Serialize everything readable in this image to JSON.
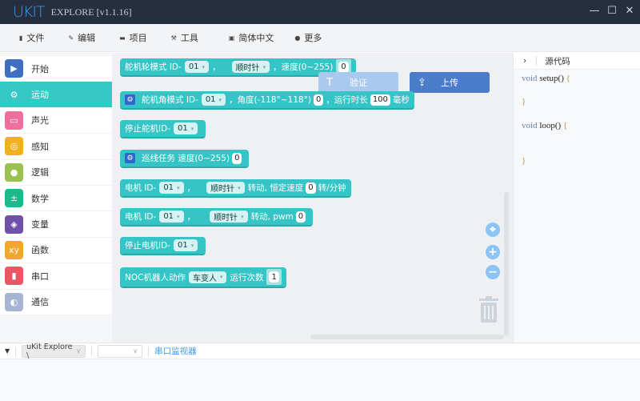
{
  "window": {
    "logo": "UKIT",
    "title": "EXPLORE [v1.1.16]",
    "minimize": "—",
    "maximize": "☐",
    "close": "✕"
  },
  "menu": [
    {
      "icon": "file-icon",
      "label": "文件"
    },
    {
      "icon": "edit-icon",
      "label": "编辑"
    },
    {
      "icon": "folder-icon",
      "label": "项目"
    },
    {
      "icon": "wrench-icon",
      "label": "工具"
    },
    {
      "icon": "language-icon",
      "label": "简体中文"
    },
    {
      "icon": "help-icon",
      "label": "更多"
    }
  ],
  "categories": [
    {
      "label": "开始",
      "color": "#3f6fc0",
      "glyph": "▶"
    },
    {
      "label": "运动",
      "color": "#35c9c6",
      "glyph": "⚙",
      "active": true
    },
    {
      "label": "声光",
      "color": "#ee6e9d",
      "glyph": "▭"
    },
    {
      "label": "感知",
      "color": "#f0b020",
      "glyph": "◎"
    },
    {
      "label": "逻辑",
      "color": "#9ac251",
      "glyph": "●"
    },
    {
      "label": "数学",
      "color": "#1db98a",
      "glyph": "±"
    },
    {
      "label": "变量",
      "color": "#7051a9",
      "glyph": "◈"
    },
    {
      "label": "函数",
      "color": "#f2a630",
      "glyph": "xy"
    },
    {
      "label": "串口",
      "color": "#e95763",
      "glyph": "▮"
    },
    {
      "label": "通信",
      "color": "#a6b5d3",
      "glyph": "◐"
    }
  ],
  "blocks": {
    "b1": {
      "t1": "舵机轮模式  ID-",
      "id": "01",
      "t2": "，",
      "dir": "顺时针",
      "t3": "，速度(0~255)",
      "speed": "0"
    },
    "b2": {
      "t1": "舵机角模式  ID-",
      "id": "01",
      "t2": "，角度(-118°~118°)",
      "angle": "0",
      "t3": "，运行时长",
      "dur": "100",
      "t4": "毫秒"
    },
    "b3": {
      "t1": "停止舵机ID-",
      "id": "01"
    },
    "b4": {
      "t1": "巡线任务   速度(0~255)",
      "speed": "0"
    },
    "b5": {
      "t1": "电机 ID-",
      "id": "01",
      "t2": "，",
      "dir": "顺时针",
      "t3": "转动,  恒定速度",
      "speed": "0",
      "t4": "转/分钟"
    },
    "b6": {
      "t1": "电机 ID-",
      "id": "01",
      "t2": "，",
      "dir": "顺时针",
      "t3": "转动, pwm",
      "pwm": "0"
    },
    "b7": {
      "t1": "停止电机ID-",
      "id": "01"
    },
    "b8": {
      "t1": "NOC机器人动作",
      "action": "车变人",
      "t2": "运行次数",
      "count": "1"
    }
  },
  "buttons": {
    "verify": "验证",
    "upload": "上传"
  },
  "code": {
    "header": "源代码",
    "lines": [
      "void",
      "setup()",
      "{",
      "}",
      "void",
      "loop()",
      "{",
      "}"
    ]
  },
  "bottom": {
    "board": "uKit Explore \\",
    "port": "",
    "monitor": "串口监视器"
  }
}
